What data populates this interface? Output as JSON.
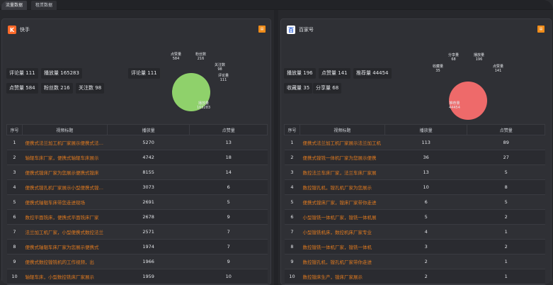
{
  "tabs": [
    "流量数据",
    "租赁数据"
  ],
  "left": {
    "platform": "快手",
    "stats": [
      {
        "label": "评论量",
        "value": "111"
      },
      {
        "label": "播放量",
        "value": "165283"
      },
      {
        "label": "点赞量",
        "value": "584"
      },
      {
        "label": "粉丝数",
        "value": "216"
      },
      {
        "label": "关注数",
        "value": "98"
      }
    ],
    "stat_extra": {
      "label": "评论量",
      "value": "111"
    },
    "pie_color": "#8fd16b",
    "pie_labels": [
      {
        "label": "点赞量",
        "value": "584"
      },
      {
        "label": "粉丝数",
        "value": "216"
      },
      {
        "label": "关注数",
        "value": "98"
      },
      {
        "label": "评论量",
        "value": "111"
      },
      {
        "label": "播放量",
        "value": "165283"
      }
    ],
    "columns": [
      "序号",
      "视频标题",
      "播放量",
      "点赞量"
    ],
    "rows": [
      {
        "idx": "1",
        "title": "便携式法兰加工机厂家展示便携式法兰加工机",
        "play": "5270",
        "like": "13"
      },
      {
        "idx": "2",
        "title": "轴辊车床厂家，便携式轴辊车床展示",
        "play": "4742",
        "like": "18"
      },
      {
        "idx": "3",
        "title": "便携式镗床厂家为您展示便携式镗床",
        "play": "8155",
        "like": "14"
      },
      {
        "idx": "4",
        "title": "便携式镗孔机厂家展示小型便携式镗孔机",
        "play": "3073",
        "like": "6"
      },
      {
        "idx": "5",
        "title": "便携式轴辊车床带您走进现场",
        "play": "2691",
        "like": "5"
      },
      {
        "idx": "6",
        "title": "数控平面铣床，便携式平面铣床厂家",
        "play": "2678",
        "like": "9"
      },
      {
        "idx": "7",
        "title": "法兰加工机厂家，小型便携式数控法兰",
        "play": "2571",
        "like": "7"
      },
      {
        "idx": "8",
        "title": "便携式轴辊车床厂家为您展示便携式",
        "play": "1974",
        "like": "7"
      },
      {
        "idx": "9",
        "title": "便携式数控镗铣机的工作视频，出",
        "play": "1966",
        "like": "9"
      },
      {
        "idx": "10",
        "title": "轴辊车床，小型数控铣床厂家展示",
        "play": "1959",
        "like": "10"
      }
    ]
  },
  "right": {
    "platform": "百家号",
    "stats": [
      {
        "label": "播放量",
        "value": "196"
      },
      {
        "label": "点赞量",
        "value": "141"
      },
      {
        "label": "推荐量",
        "value": "44454"
      },
      {
        "label": "收藏量",
        "value": "35"
      },
      {
        "label": "分享量",
        "value": "68"
      }
    ],
    "pie_color": "#ee6a6a",
    "pie_labels": [
      {
        "label": "分享量",
        "value": "68"
      },
      {
        "label": "播放量",
        "value": "196"
      },
      {
        "label": "收藏量",
        "value": "35"
      },
      {
        "label": "点赞量",
        "value": "141"
      },
      {
        "label": "推荐量",
        "value": "44454"
      }
    ],
    "columns": [
      "序号",
      "视频标题",
      "播放量",
      "点赞量"
    ],
    "rows": [
      {
        "idx": "1",
        "title": "便携式法兰加工机厂家展示法兰加工机",
        "play": "113",
        "like": "89"
      },
      {
        "idx": "2",
        "title": "便携式镗铣一体机厂家为您展示便携",
        "play": "36",
        "like": "27"
      },
      {
        "idx": "3",
        "title": "数控法兰车床厂家，法兰车床厂家展",
        "play": "13",
        "like": "5"
      },
      {
        "idx": "4",
        "title": "数控镗孔机，镗孔机厂家为您展示",
        "play": "10",
        "like": "8"
      },
      {
        "idx": "5",
        "title": "便携式镗床厂家，镗床厂家带你走进",
        "play": "6",
        "like": "5"
      },
      {
        "idx": "6",
        "title": "小型镗铣一体机厂家，镗铣一体机展",
        "play": "5",
        "like": "2"
      },
      {
        "idx": "7",
        "title": "小型镗铣机床，数控机床厂家专业",
        "play": "4",
        "like": "1"
      },
      {
        "idx": "8",
        "title": "数控镗铣一体机厂家，镗铣一体机",
        "play": "3",
        "like": "2"
      },
      {
        "idx": "9",
        "title": "数控镗孔机，镗孔机厂家带你走进",
        "play": "2",
        "like": "1"
      },
      {
        "idx": "10",
        "title": "数控镗床生产，镗床厂家展示",
        "play": "2",
        "like": "1"
      }
    ]
  }
}
